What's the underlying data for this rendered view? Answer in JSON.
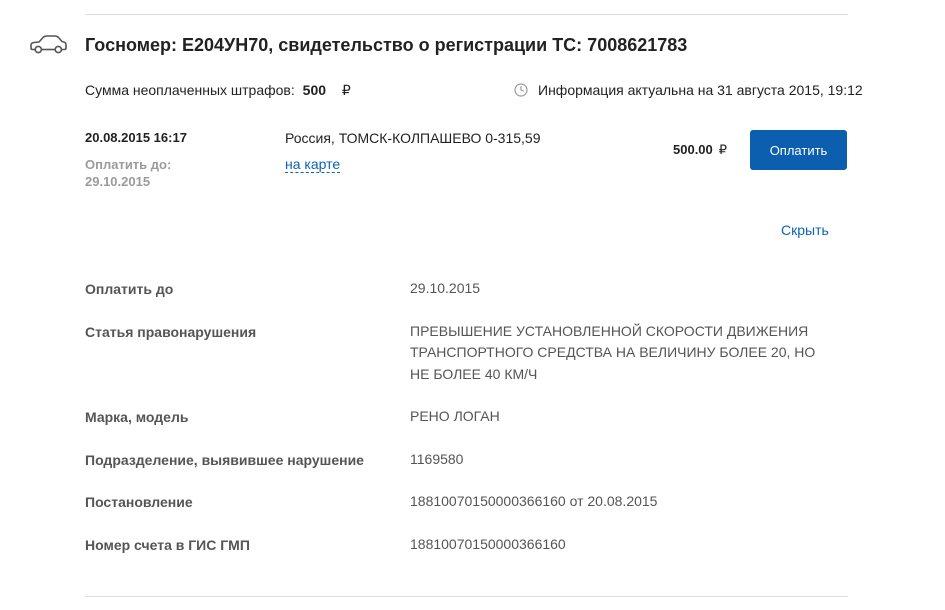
{
  "header": {
    "car_icon": "car-icon",
    "title": "Госномер: Е204УН70, свидетельство о регистрации ТС: 7008621783"
  },
  "summary": {
    "unpaid_label": "Сумма неоплаченных штрафов:",
    "unpaid_amount": "500",
    "currency": "₽",
    "clock_icon": "clock-icon",
    "actual_info": "Информация актуальна на 31 августа 2015, 19:12"
  },
  "fine": {
    "date": "20.08.2015 16:17",
    "pay_until": "Оплатить до: 29.10.2015",
    "location": "Россия, ТОМСК-КОЛПАШЕВО 0-315,59",
    "map_link": "на карте",
    "amount": "500.00",
    "currency": "₽",
    "pay_button": "Оплатить",
    "pay_button_color": "#0c5fae",
    "hide_link": "Скрыть"
  },
  "details": [
    {
      "label": "Оплатить до",
      "value": "29.10.2015"
    },
    {
      "label": "Статья правонарушения",
      "value": "ПРЕВЫШЕНИЕ УСТАНОВЛЕННОЙ СКОРОСТИ ДВИЖЕНИЯ ТРАНСПОРТНОГО СРЕДСТВА НА ВЕЛИЧИНУ БОЛЕЕ 20, НО НЕ БОЛЕЕ 40 КМ/Ч"
    },
    {
      "label": "Марка, модель",
      "value": "РЕНО ЛОГАН"
    },
    {
      "label": "Подразделение, выявившее нарушение",
      "value": "1169580"
    },
    {
      "label": "Постановление",
      "value": "18810070150000366160 от 20.08.2015"
    },
    {
      "label": "Номер счета в ГИС ГМП",
      "value": "18810070150000366160"
    }
  ]
}
